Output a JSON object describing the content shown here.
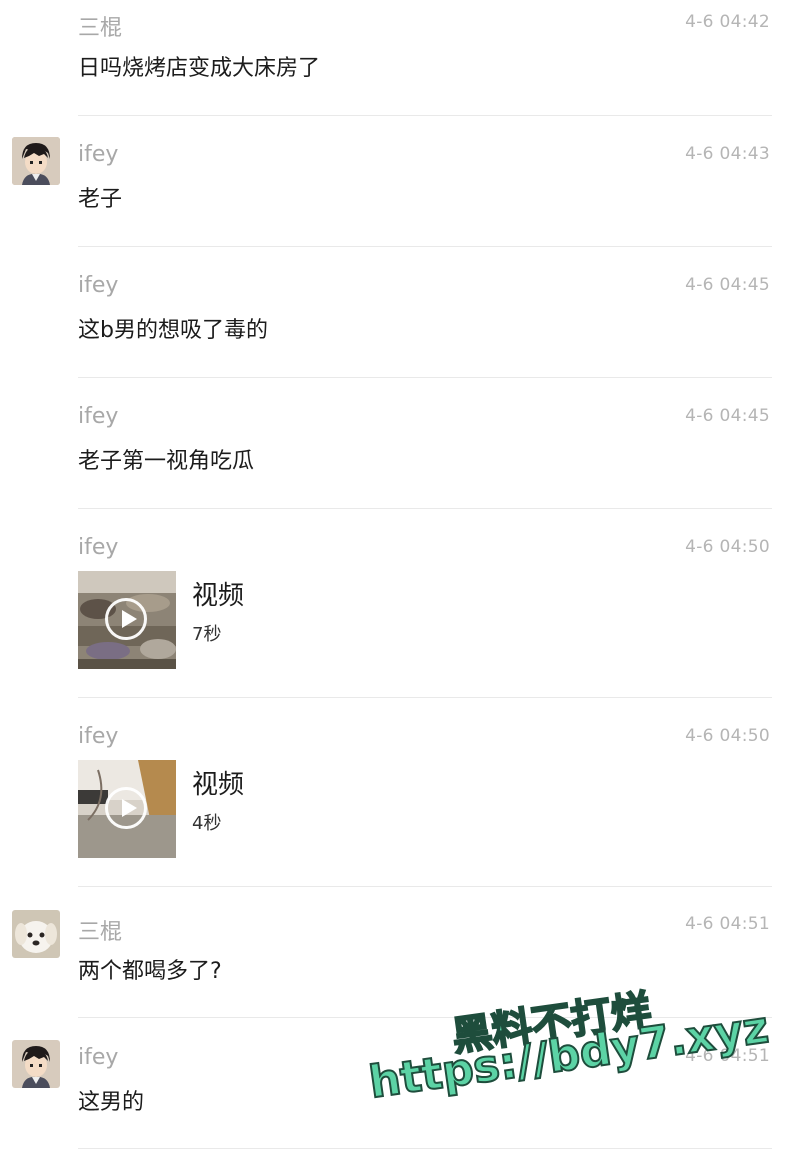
{
  "messages": [
    {
      "sender": "三棍",
      "time": "4-6 04:42",
      "text": "日吗烧烤店变成大床房了"
    },
    {
      "sender": "ifey",
      "time": "4-6 04:43",
      "text": "老子"
    },
    {
      "sender": "ifey",
      "time": "4-6 04:45",
      "text": "这b男的想吸了毒的"
    },
    {
      "sender": "ifey",
      "time": "4-6 04:45",
      "text": "老子第一视角吃瓜"
    },
    {
      "sender": "ifey",
      "time": "4-6 04:50",
      "video_title": "视频",
      "video_duration": "7秒"
    },
    {
      "sender": "ifey",
      "time": "4-6 04:50",
      "video_title": "视频",
      "video_duration": "4秒"
    },
    {
      "sender": "三棍",
      "time": "4-6 04:51",
      "text": "两个都喝多了?"
    },
    {
      "sender": "ifey",
      "time": "4-6 04:51",
      "text": "这男的"
    }
  ],
  "watermark": {
    "line1": "黑料不打烊",
    "line2": "https://bdy7.xyz"
  },
  "colors": {
    "sender": "#a8a8a8",
    "time": "#b5b5b5",
    "watermark_fill": "#5cd3a5",
    "watermark_stroke": "#1e4d3c"
  },
  "icons": {
    "video_play": "play-circle-icon"
  }
}
